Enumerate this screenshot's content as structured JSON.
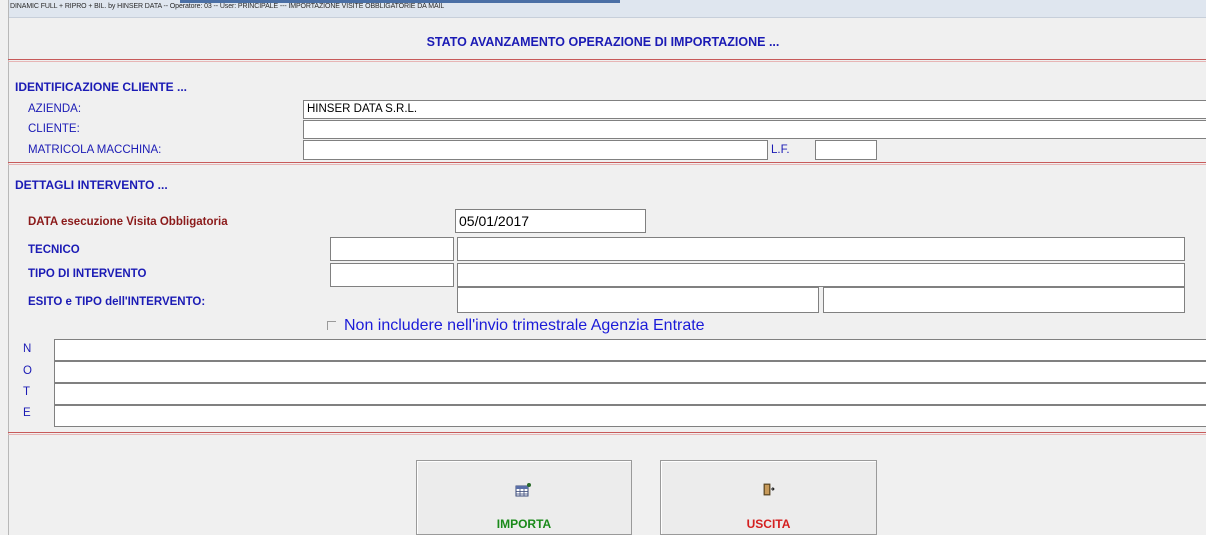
{
  "window": {
    "title": "DINAMIC FULL + RIPRO + BIL. by HINSER DATA --  Operatore: 03 -- User: PRINCIPALE --- IMPORTAZIONE VISITE OBBLIGATORIE DA MAIL"
  },
  "heading": "STATO AVANZAMENTO OPERAZIONE DI IMPORTAZIONE ...",
  "client_section": {
    "title": "IDENTIFICAZIONE CLIENTE ...",
    "azienda_label": "AZIENDA:",
    "azienda_value": "HINSER DATA S.R.L.",
    "cliente_label": "CLIENTE:",
    "cliente_value": "",
    "matricola_label": "MATRICOLA MACCHINA:",
    "matricola_value": "",
    "lf_label": "L.F.",
    "lf_value": ""
  },
  "intervento_section": {
    "title": "DETTAGLI INTERVENTO  ...",
    "data_label": "DATA esecuzione Visita Obbligatoria",
    "data_value": "05/01/2017",
    "tecnico_label": "TECNICO",
    "tipo_label": "TIPO DI INTERVENTO",
    "esito_label": "ESITO e TIPO dell'INTERVENTO:",
    "checkbox_label": "Non includere nell'invio trimestrale Agenzia Entrate"
  },
  "note_section": {
    "letters": [
      "N",
      "O",
      "T",
      "E"
    ]
  },
  "buttons": {
    "importa": "IMPORTA",
    "uscita": "USCITA"
  },
  "colors": {
    "label_blue": "#1b1bb5",
    "data_label_red": "#8b1a1a",
    "importa_green": "#1a8a1a",
    "uscita_red": "#d42020",
    "separator_red": "#c75a5a"
  }
}
